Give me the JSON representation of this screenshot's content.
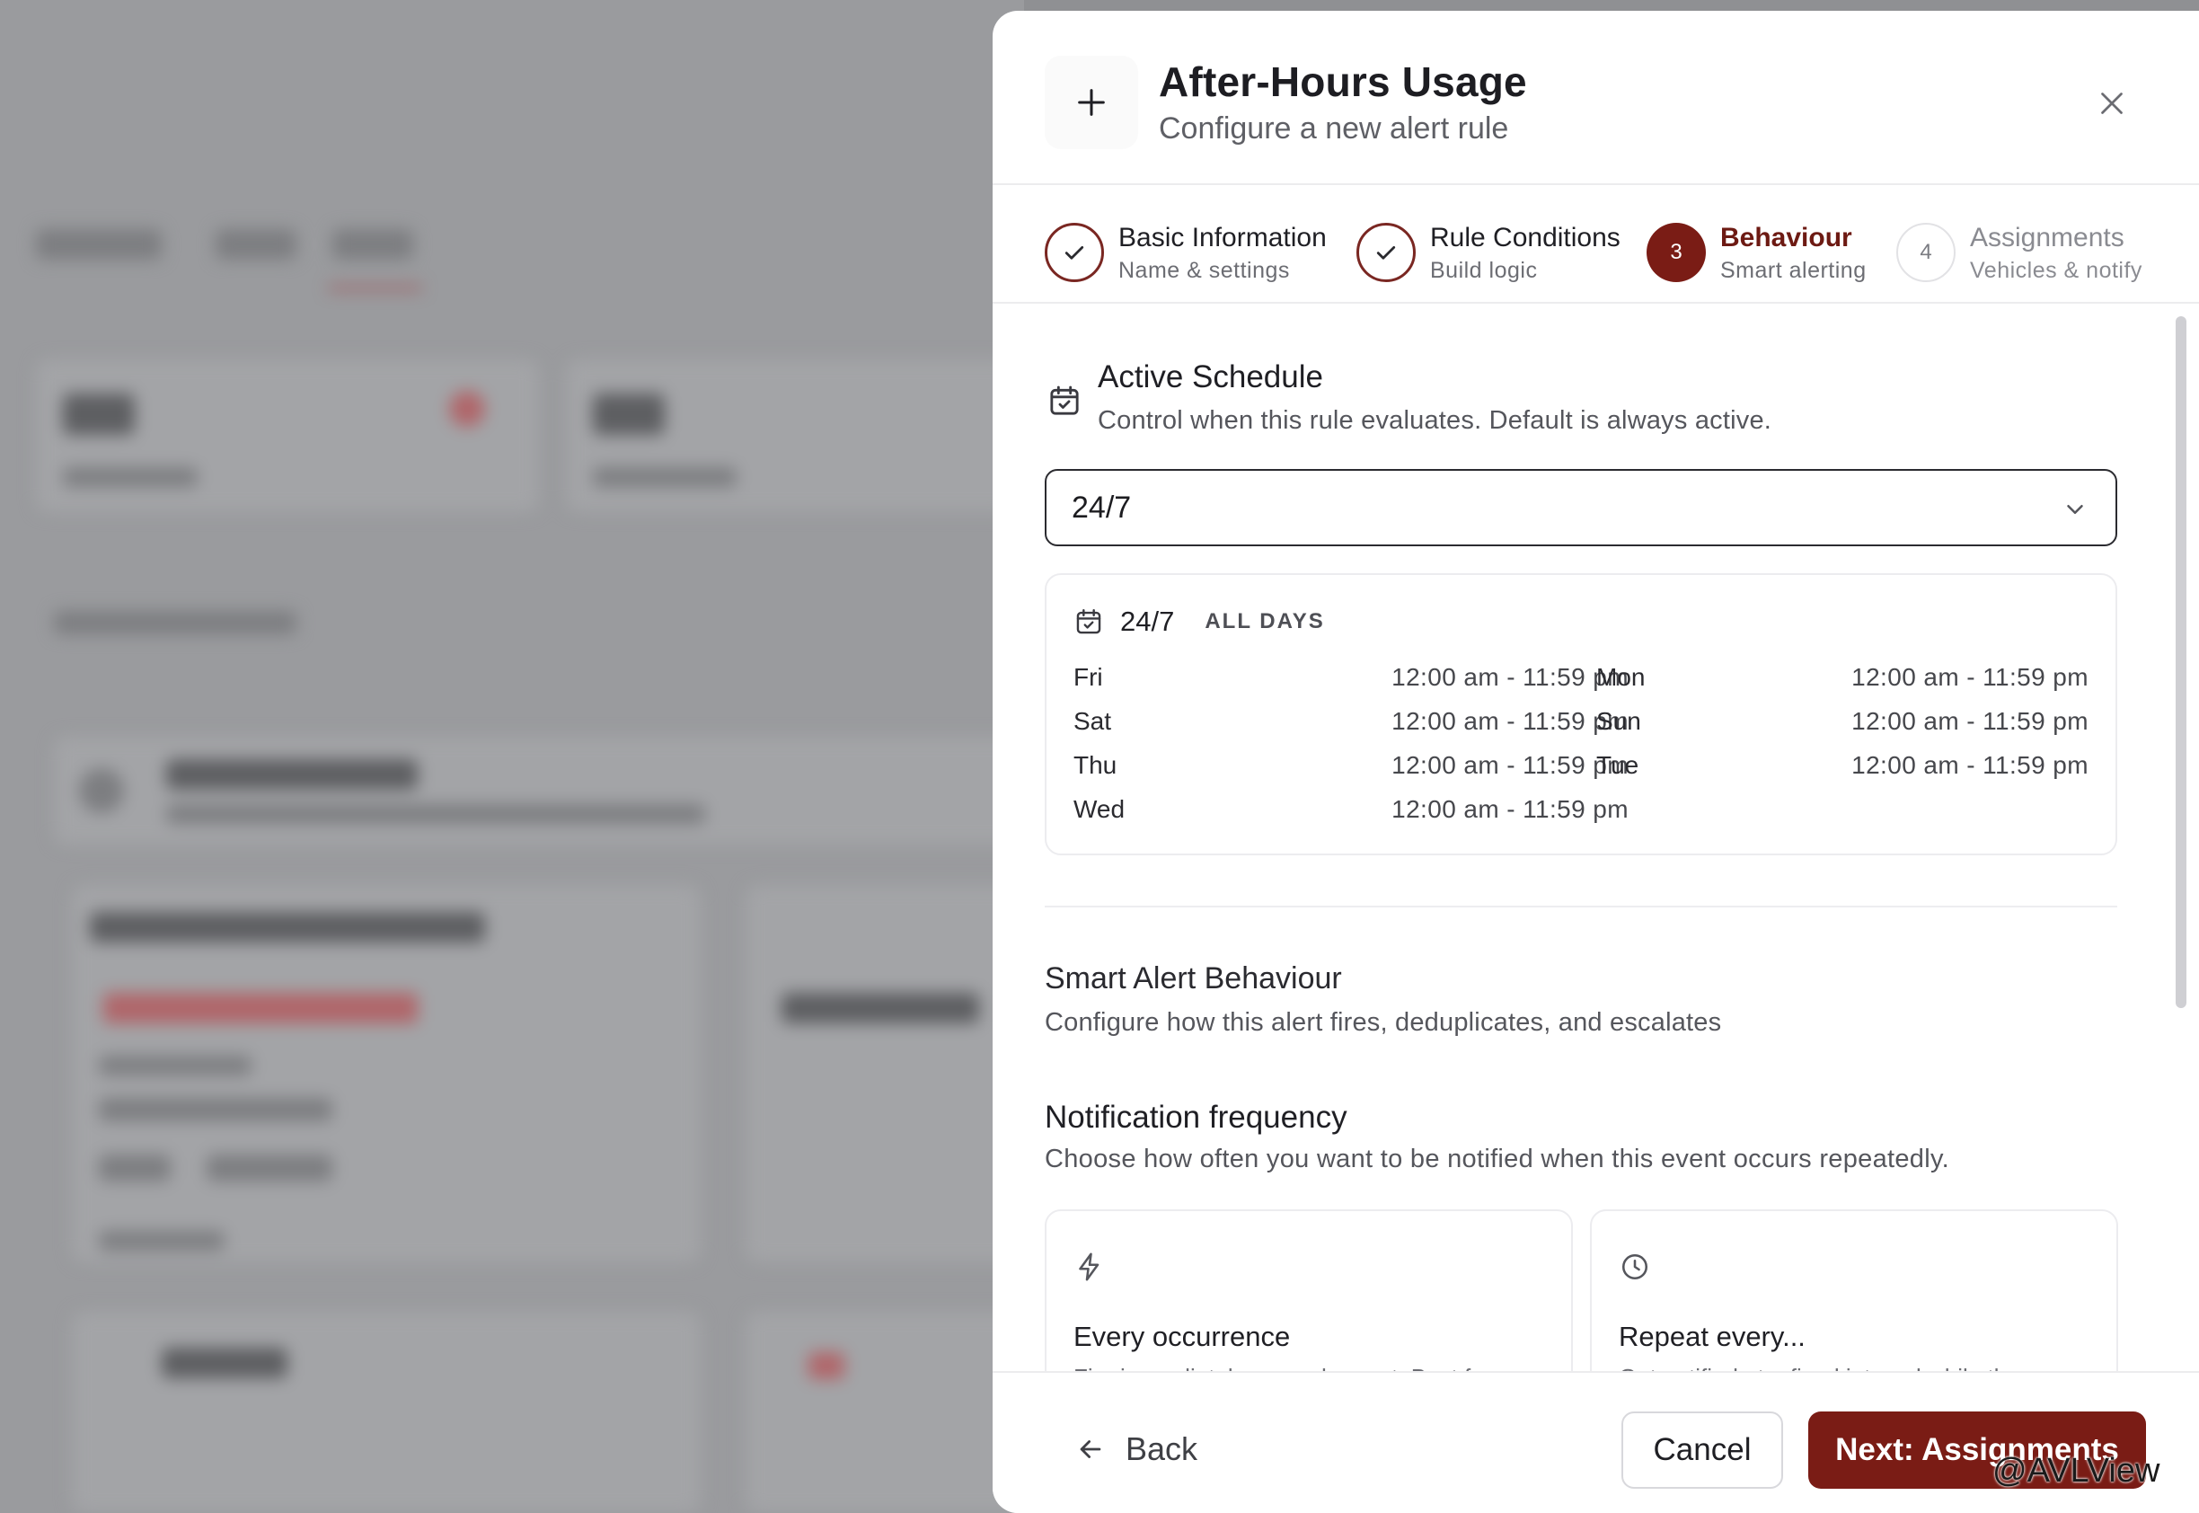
{
  "modal": {
    "title": "After-Hours Usage",
    "subtitle": "Configure a new alert rule",
    "icon": "plus-icon",
    "close_icon": "close-icon"
  },
  "stepper": {
    "steps": [
      {
        "label": "Basic Information",
        "sub": "Name & settings",
        "state": "done"
      },
      {
        "label": "Rule Conditions",
        "sub": "Build logic",
        "state": "done"
      },
      {
        "number": "3",
        "label": "Behaviour",
        "sub": "Smart alerting",
        "state": "active"
      },
      {
        "number": "4",
        "label": "Assignments",
        "sub": "Vehicles & notify",
        "state": "pending"
      }
    ]
  },
  "active_schedule": {
    "title": "Active Schedule",
    "subtitle": "Control when this rule evaluates. Default is always active.",
    "selected": "24/7",
    "card": {
      "name": "24/7",
      "badge": "ALL DAYS",
      "left": [
        {
          "day": "Fri",
          "time": "12:00 am - 11:59 pm"
        },
        {
          "day": "Sat",
          "time": "12:00 am - 11:59 pm"
        },
        {
          "day": "Thu",
          "time": "12:00 am - 11:59 pm"
        },
        {
          "day": "Wed",
          "time": "12:00 am - 11:59 pm"
        }
      ],
      "right": [
        {
          "day": "Mon",
          "time": "12:00 am - 11:59 pm"
        },
        {
          "day": "Sun",
          "time": "12:00 am - 11:59 pm"
        },
        {
          "day": "Tue",
          "time": "12:00 am - 11:59 pm"
        }
      ]
    }
  },
  "smart_alert": {
    "title": "Smart Alert Behaviour",
    "subtitle": "Configure how this alert fires, deduplicates, and escalates"
  },
  "notification_frequency": {
    "title": "Notification frequency",
    "subtitle": "Choose how often you want to be notified when this event occurs repeatedly.",
    "options": [
      {
        "icon": "lightning-icon",
        "title": "Every occurrence",
        "desc": "Fire immediately on each event. Best for"
      },
      {
        "icon": "clock-icon",
        "title": "Repeat every...",
        "desc": "Get notified at a fixed interval while the"
      }
    ]
  },
  "footer": {
    "back_label": "Back",
    "cancel_label": "Cancel",
    "next_label": "Next: Assignments"
  },
  "watermark": "@AVLView",
  "colors": {
    "accent": "#7a1c15",
    "accent_border": "#7a2722",
    "overlay": "#9a9b9e"
  }
}
